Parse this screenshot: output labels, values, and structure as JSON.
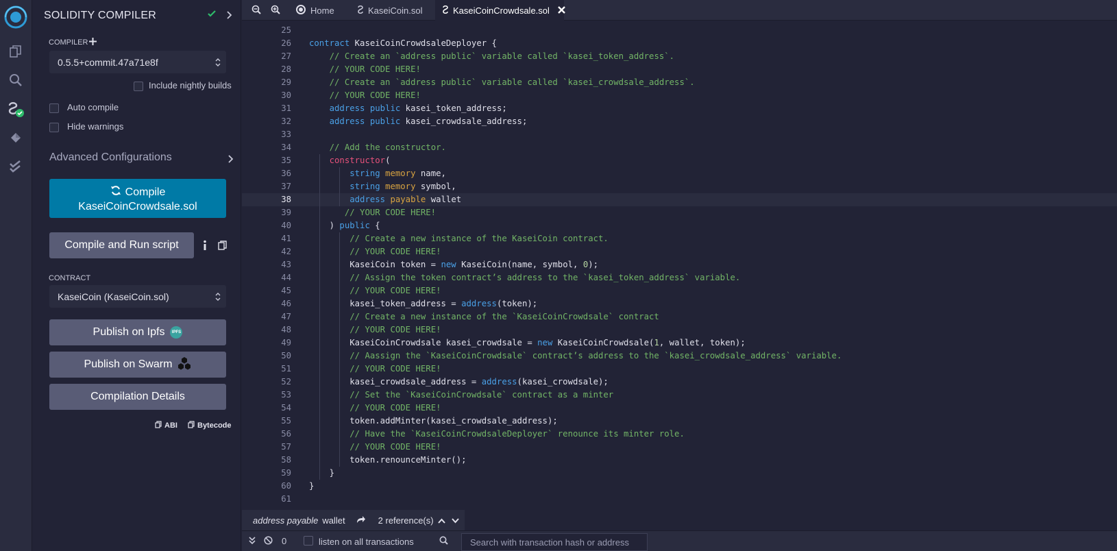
{
  "panel": {
    "title": "SOLIDITY COMPILER",
    "compiler_label": "COMPILER",
    "compiler_version": "0.5.5+commit.47a71e8f",
    "include_nightly": "Include nightly builds",
    "auto_compile": "Auto compile",
    "hide_warnings": "Hide warnings",
    "advanced": "Advanced Configurations",
    "compile_line1": "Compile",
    "compile_line2": "KaseiCoinCrowdsale.sol",
    "compile_run": "Compile and Run script",
    "contract_label": "CONTRACT",
    "contract_value": "KaseiCoin (KaseiCoin.sol)",
    "publish_ipfs": "Publish on Ipfs",
    "ipfs_badge": "IPFS",
    "publish_swarm": "Publish on Swarm",
    "compilation_details": "Compilation Details",
    "abi": "ABI",
    "bytecode": "Bytecode"
  },
  "tabs": [
    {
      "label": "Home"
    },
    {
      "label": "KaseiCoin.sol"
    },
    {
      "label": "KaseiCoinCrowdsale.sol"
    }
  ],
  "editor": {
    "current_line": 38,
    "lines": [
      {
        "n": "25",
        "segs": []
      },
      {
        "n": "26",
        "segs": [
          [
            "k",
            "contract"
          ],
          [
            "t",
            " KaseiCoinCrowdsaleDeployer {"
          ]
        ]
      },
      {
        "n": "27",
        "segs": [
          [
            "t",
            "    "
          ],
          [
            "c",
            "// Create an `address public` variable called `kasei_token_address`."
          ]
        ]
      },
      {
        "n": "28",
        "segs": [
          [
            "t",
            "    "
          ],
          [
            "c",
            "// YOUR CODE HERE!"
          ]
        ]
      },
      {
        "n": "29",
        "segs": [
          [
            "t",
            "    "
          ],
          [
            "c",
            "// Create an `address public` variable called `kasei_crowdsale_address`."
          ]
        ]
      },
      {
        "n": "30",
        "segs": [
          [
            "t",
            "    "
          ],
          [
            "c",
            "// YOUR CODE HERE!"
          ]
        ]
      },
      {
        "n": "31",
        "segs": [
          [
            "t",
            "    "
          ],
          [
            "k",
            "address"
          ],
          [
            "t",
            " "
          ],
          [
            "k",
            "public"
          ],
          [
            "t",
            " kasei_token_address;"
          ]
        ]
      },
      {
        "n": "32",
        "segs": [
          [
            "t",
            "    "
          ],
          [
            "k",
            "address"
          ],
          [
            "t",
            " "
          ],
          [
            "k",
            "public"
          ],
          [
            "t",
            " kasei_crowdsale_address;"
          ]
        ]
      },
      {
        "n": "33",
        "segs": []
      },
      {
        "n": "34",
        "segs": [
          [
            "t",
            "    "
          ],
          [
            "c",
            "// Add the constructor."
          ]
        ]
      },
      {
        "n": "35",
        "segs": [
          [
            "t",
            "    "
          ],
          [
            "p",
            "constructor"
          ],
          [
            "t",
            "("
          ]
        ]
      },
      {
        "n": "36",
        "segs": [
          [
            "t",
            "        "
          ],
          [
            "k",
            "string"
          ],
          [
            "t",
            " "
          ],
          [
            "m",
            "memory"
          ],
          [
            "t",
            " name,"
          ]
        ]
      },
      {
        "n": "37",
        "segs": [
          [
            "t",
            "        "
          ],
          [
            "k",
            "string"
          ],
          [
            "t",
            " "
          ],
          [
            "m",
            "memory"
          ],
          [
            "t",
            " symbol,"
          ]
        ]
      },
      {
        "n": "38",
        "segs": [
          [
            "t",
            "        "
          ],
          [
            "k",
            "address"
          ],
          [
            "t",
            " "
          ],
          [
            "m",
            "payable"
          ],
          [
            "t",
            " wallet"
          ]
        ]
      },
      {
        "n": "39",
        "segs": [
          [
            "t",
            "       "
          ],
          [
            "c",
            "// YOUR CODE HERE!"
          ]
        ]
      },
      {
        "n": "40",
        "segs": [
          [
            "t",
            "    ) "
          ],
          [
            "k",
            "public"
          ],
          [
            "t",
            " {"
          ]
        ]
      },
      {
        "n": "41",
        "segs": [
          [
            "t",
            "        "
          ],
          [
            "c",
            "// Create a new instance of the KaseiCoin contract."
          ]
        ]
      },
      {
        "n": "42",
        "segs": [
          [
            "t",
            "        "
          ],
          [
            "c",
            "// YOUR CODE HERE!"
          ]
        ]
      },
      {
        "n": "43",
        "segs": [
          [
            "t",
            "        KaseiCoin token = "
          ],
          [
            "k",
            "new"
          ],
          [
            "t",
            " KaseiCoin(name, symbol, "
          ],
          [
            "n",
            "0"
          ],
          [
            "t",
            ");"
          ]
        ]
      },
      {
        "n": "44",
        "segs": [
          [
            "t",
            "        "
          ],
          [
            "c",
            "// Assign the token contract’s address to the `kasei_token_address` variable."
          ]
        ]
      },
      {
        "n": "45",
        "segs": [
          [
            "t",
            "        "
          ],
          [
            "c",
            "// YOUR CODE HERE!"
          ]
        ]
      },
      {
        "n": "46",
        "segs": [
          [
            "t",
            "        kasei_token_address = "
          ],
          [
            "k",
            "address"
          ],
          [
            "t",
            "(token);"
          ]
        ]
      },
      {
        "n": "47",
        "segs": [
          [
            "t",
            "        "
          ],
          [
            "c",
            "// Create a new instance of the `KaseiCoinCrowdsale` contract"
          ]
        ]
      },
      {
        "n": "48",
        "segs": [
          [
            "t",
            "        "
          ],
          [
            "c",
            "// YOUR CODE HERE!"
          ]
        ]
      },
      {
        "n": "49",
        "segs": [
          [
            "t",
            "        KaseiCoinCrowdsale kasei_crowdsale = "
          ],
          [
            "k",
            "new"
          ],
          [
            "t",
            " KaseiCoinCrowdsale("
          ],
          [
            "n",
            "1"
          ],
          [
            "t",
            ", wallet, token);"
          ]
        ]
      },
      {
        "n": "50",
        "segs": [
          [
            "t",
            "        "
          ],
          [
            "c",
            "// Aassign the `KaseiCoinCrowdsale` contract’s address to the `kasei_crowdsale_address` variable."
          ]
        ]
      },
      {
        "n": "51",
        "segs": [
          [
            "t",
            "        "
          ],
          [
            "c",
            "// YOUR CODE HERE!"
          ]
        ]
      },
      {
        "n": "52",
        "segs": [
          [
            "t",
            "        kasei_crowdsale_address = "
          ],
          [
            "k",
            "address"
          ],
          [
            "t",
            "(kasei_crowdsale);"
          ]
        ]
      },
      {
        "n": "53",
        "segs": [
          [
            "t",
            "        "
          ],
          [
            "c",
            "// Set the `KaseiCoinCrowdsale` contract as a minter"
          ]
        ]
      },
      {
        "n": "54",
        "segs": [
          [
            "t",
            "        "
          ],
          [
            "c",
            "// YOUR CODE HERE!"
          ]
        ]
      },
      {
        "n": "55",
        "segs": [
          [
            "t",
            "        token.addMinter(kasei_crowdsale_address);"
          ]
        ]
      },
      {
        "n": "56",
        "segs": [
          [
            "t",
            "        "
          ],
          [
            "c",
            "// Have the `KaseiCoinCrowdsaleDeployer` renounce its minter role."
          ]
        ]
      },
      {
        "n": "57",
        "segs": [
          [
            "t",
            "        "
          ],
          [
            "c",
            "// YOUR CODE HERE!"
          ]
        ]
      },
      {
        "n": "58",
        "segs": [
          [
            "t",
            "        token.renounceMinter();"
          ]
        ]
      },
      {
        "n": "59",
        "segs": [
          [
            "t",
            "    }"
          ]
        ]
      },
      {
        "n": "60",
        "segs": [
          [
            "t",
            "}"
          ]
        ]
      },
      {
        "n": "61",
        "segs": []
      }
    ]
  },
  "refbar": {
    "decl_type": "address payable",
    "decl_name": "wallet",
    "references": "2 reference(s)"
  },
  "terminal": {
    "count": "0",
    "listen_label": "listen on all transactions",
    "search_placeholder": "Search with transaction hash or address"
  },
  "colors": {
    "accent": "#007aa6",
    "success": "#2ebd6b",
    "button_gray": "#595c76"
  }
}
